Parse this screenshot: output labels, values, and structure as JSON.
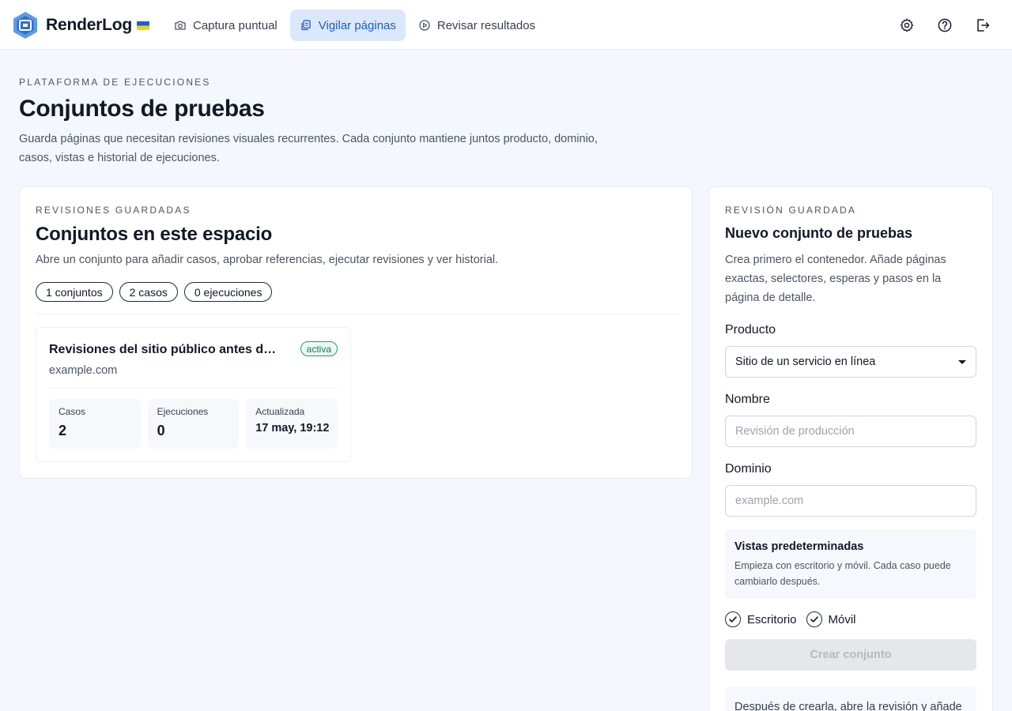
{
  "app": {
    "name": "RenderLog",
    "flag_icon": "ukraine-flag-icon",
    "logo_icon": "renderlog-logo-icon",
    "accent_color": "#1d5fbf"
  },
  "nav": {
    "tabs": [
      {
        "label": "Captura puntual",
        "icon": "camera-icon",
        "active": false
      },
      {
        "label": "Vigilar páginas",
        "icon": "copy-icon",
        "active": true
      },
      {
        "label": "Revisar resultados",
        "icon": "play-icon",
        "active": false
      }
    ],
    "actions": [
      "gear-icon",
      "help-icon",
      "logout-icon"
    ]
  },
  "page": {
    "eyebrow": "PLATAFORMA DE EJECUCIONES",
    "title": "Conjuntos de pruebas",
    "description": "Guarda páginas que necesitan revisiones visuales recurrentes. Cada conjunto mantiene juntos producto, dominio, casos, vistas e historial de ejecuciones."
  },
  "saved": {
    "eyebrow": "REVISIONES GUARDADAS",
    "title": "Conjuntos en este espacio",
    "description": "Abre un conjunto para añadir casos, aprobar referencias, ejecutar revisiones y ver historial.",
    "stats": [
      "1 conjuntos",
      "2 casos",
      "0 ejecuciones"
    ],
    "suites": [
      {
        "name": "Revisiones del sitio público antes de lanzar",
        "status": "activa",
        "domain": "example.com",
        "metrics": [
          {
            "label": "Casos",
            "value": "2"
          },
          {
            "label": "Ejecuciones",
            "value": "0"
          },
          {
            "label": "Actualizada",
            "value": "17 may, 19:12"
          }
        ]
      }
    ]
  },
  "form": {
    "eyebrow": "REVISIÓN GUARDADA",
    "title": "Nuevo conjunto de pruebas",
    "description": "Crea primero el contenedor. Añade páginas exactas, selectores, esperas y pasos en la página de detalle.",
    "product_label": "Producto",
    "product_value": "Sitio de un servicio en línea",
    "name_label": "Nombre",
    "name_placeholder": "Revisión de producción",
    "domain_label": "Dominio",
    "domain_placeholder": "example.com",
    "views_title": "Vistas predeterminadas",
    "views_hint": "Empieza con escritorio y móvil. Cada caso puede cambiarlo después.",
    "views": [
      {
        "label": "Escritorio",
        "checked": true
      },
      {
        "label": "Móvil",
        "checked": true
      }
    ],
    "submit_label": "Crear conjunto",
    "after_text": "Después de crearla, abre la revisión y añade"
  }
}
